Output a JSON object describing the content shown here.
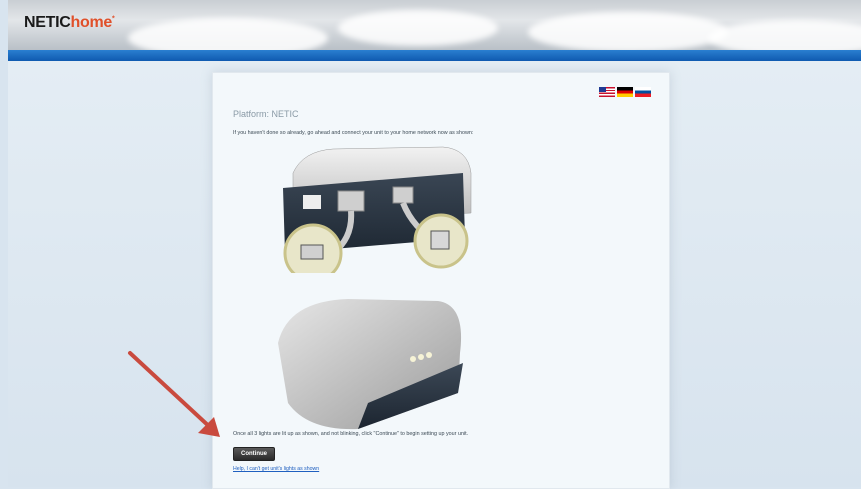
{
  "header": {
    "logo_main": "NETIC",
    "logo_accent": "home",
    "logo_mark": "*"
  },
  "panel": {
    "flags": [
      "us-flag-icon",
      "germany-flag-icon",
      "slovenia-flag-icon"
    ],
    "platform_label": "Platform: NETIC",
    "instruction": "If you haven't done so already, go ahead and connect your unit to your home network now as shown:",
    "final_instruction": "Once all 3 lights are lit up as shown, and not blinking, click \"Continue\" to begin setting up your unit.",
    "continue_label": "Continue",
    "help_link": "Help, I can't get unit's lights as shown"
  },
  "colors": {
    "accent": "#e0502a",
    "header_bar": "#1e6ec4",
    "arrow": "#c94a3e",
    "link": "#2060c0"
  }
}
